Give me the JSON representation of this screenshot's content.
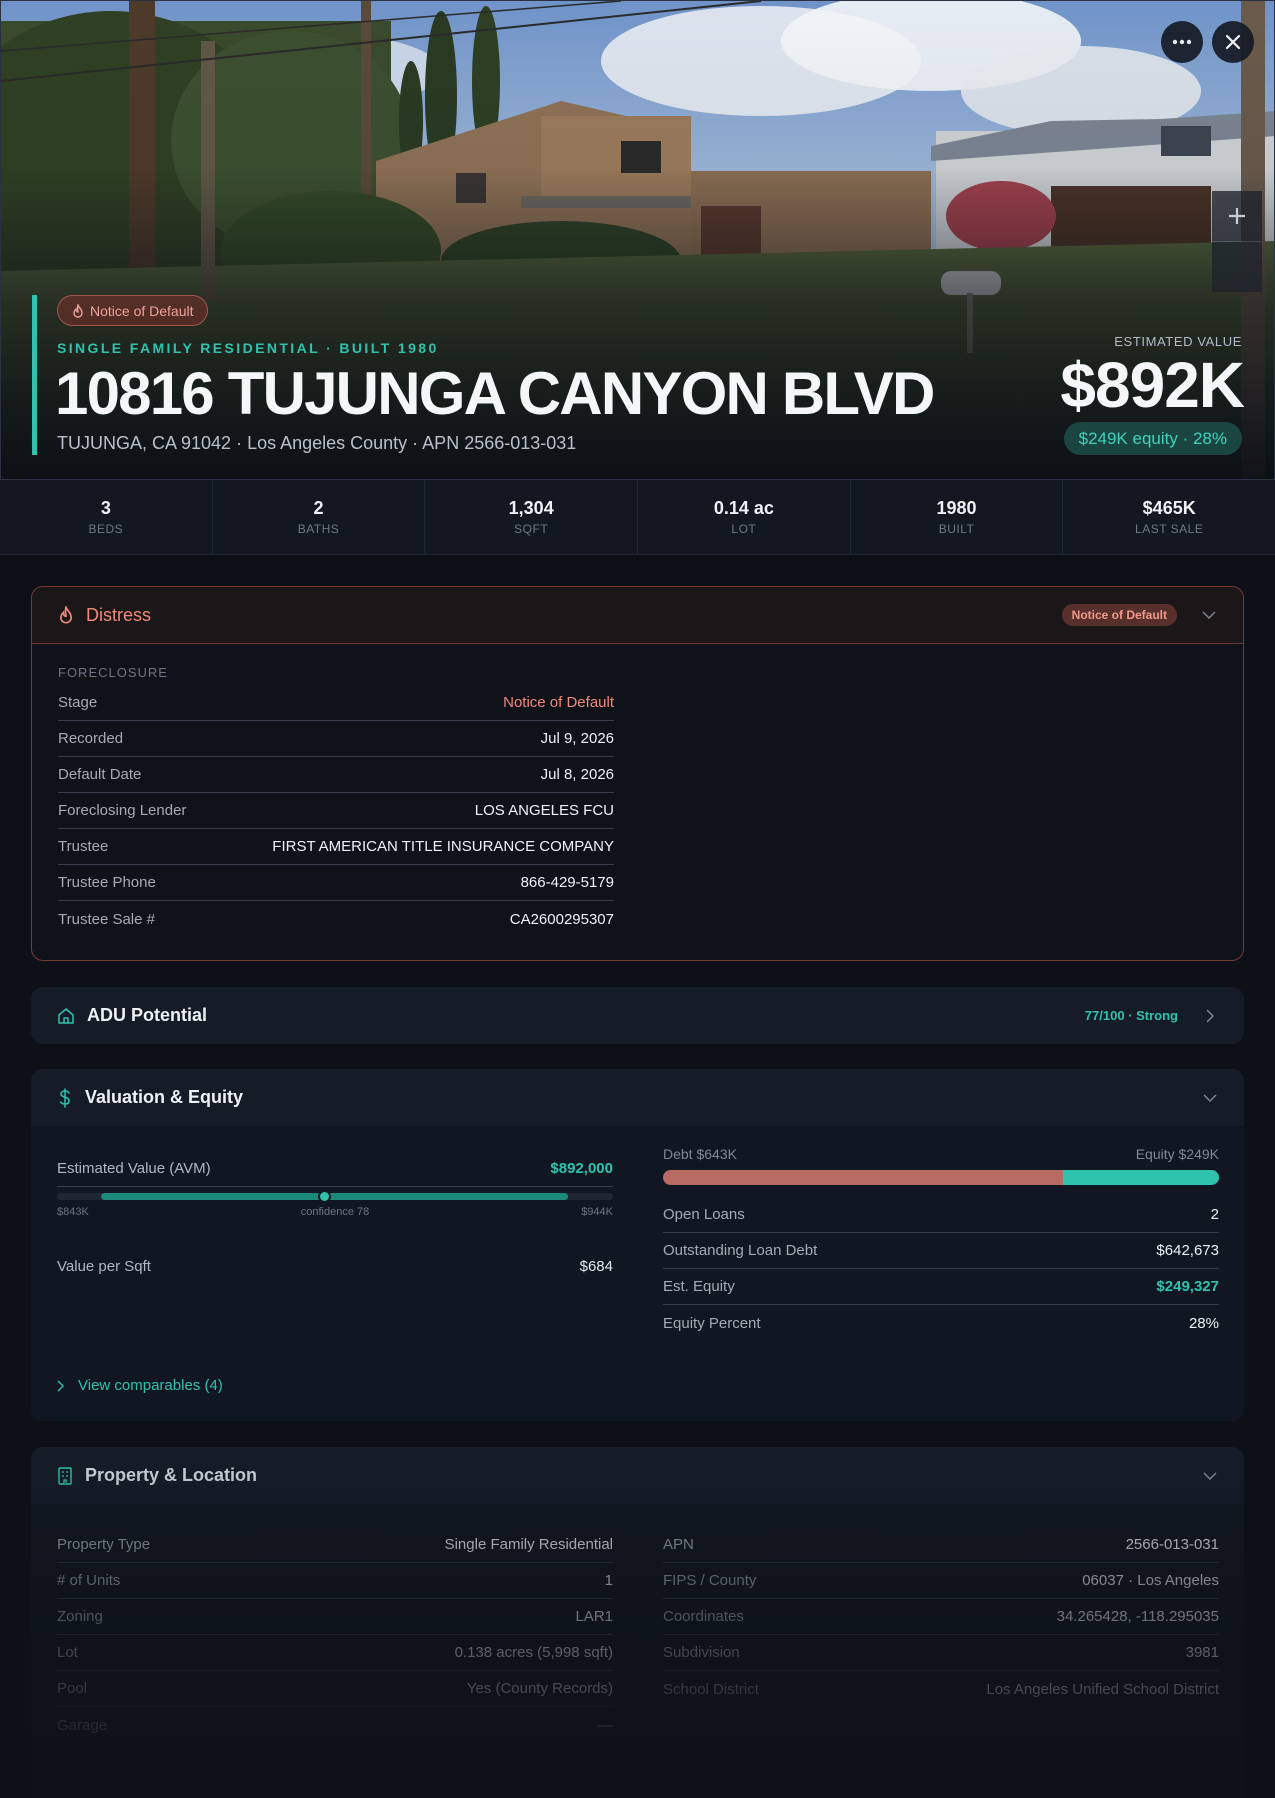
{
  "hero": {
    "status_badge": "Notice of Default",
    "subtitle": "SINGLE FAMILY RESIDENTIAL · BUILT 1980",
    "title": "10816 TUJUNGA CANYON BLVD",
    "address_line": "TUJUNGA, CA 91042 · Los Angeles County · APN 2566-013-031",
    "estimated_label": "ESTIMATED VALUE",
    "estimated_value": "$892K",
    "equity_summary": "$249K equity · 28%",
    "icons": {
      "more": "more-horizontal-icon",
      "close": "close-icon",
      "zoom_in": "plus-icon",
      "zoom_out": "minus-icon",
      "badge": "flame-icon"
    }
  },
  "stats": [
    {
      "value": "3",
      "label": "BEDS"
    },
    {
      "value": "2",
      "label": "BATHS"
    },
    {
      "value": "1,304",
      "label": "SQFT"
    },
    {
      "value": "0.14 ac",
      "label": "LOT"
    },
    {
      "value": "1980",
      "label": "BUILT"
    },
    {
      "value": "$465K",
      "label": "LAST SALE"
    }
  ],
  "distress": {
    "title": "Distress",
    "badge": "Notice of Default",
    "section_label": "FORECLOSURE",
    "rows": [
      {
        "label": "Stage",
        "value": "Notice of Default"
      },
      {
        "label": "Recorded",
        "value": "Jul 9, 2026"
      },
      {
        "label": "Default Date",
        "value": "Jul 8, 2026"
      },
      {
        "label": "Foreclosing Lender",
        "value": "LOS ANGELES FCU"
      },
      {
        "label": "Trustee",
        "value": "FIRST AMERICAN TITLE INSURANCE COMPANY"
      },
      {
        "label": "Trustee Phone",
        "value": "866-429-5179"
      },
      {
        "label": "Trustee Sale #",
        "value": "CA2600295307"
      }
    ]
  },
  "adu": {
    "title": "ADU Potential",
    "score": "77/100 · Strong"
  },
  "valuation": {
    "title": "Valuation & Equity",
    "avm_label": "Estimated Value (AVM)",
    "avm_value": "$892,000",
    "range_low": "$843K",
    "range_high": "$944K",
    "confidence": "confidence 78",
    "range_position": 0.48,
    "value_per_sqft_label": "Value per Sqft",
    "value_per_sqft": "$684",
    "debt_label": "Debt $643K",
    "equity_label": "Equity $249K",
    "debt_fraction": 0.72,
    "loans": [
      {
        "label": "Open Loans",
        "value": "2"
      },
      {
        "label": "Outstanding Loan Debt",
        "value": "$642,673"
      },
      {
        "label": "Est. Equity",
        "value": "$249,327"
      },
      {
        "label": "Equity Percent",
        "value": "28%"
      }
    ],
    "comparables_link": "View comparables (4)"
  },
  "property": {
    "title": "Property & Location",
    "left_rows": [
      {
        "label": "Property Type",
        "value": "Single Family Residential"
      },
      {
        "label": "# of Units",
        "value": "1"
      },
      {
        "label": "Zoning",
        "value": "LAR1"
      },
      {
        "label": "Lot",
        "value": "0.138 acres (5,998 sqft)"
      },
      {
        "label": "Pool",
        "value": "Yes (County Records)"
      },
      {
        "label": "Garage",
        "value": "—"
      }
    ],
    "right_rows": [
      {
        "label": "APN",
        "value": "2566-013-031"
      },
      {
        "label": "FIPS / County",
        "value": "06037 · Los Angeles"
      },
      {
        "label": "Coordinates",
        "value": "34.265428, -118.295035"
      },
      {
        "label": "Subdivision",
        "value": "3981"
      },
      {
        "label": "School District",
        "value": "Los Angeles Unified School District"
      }
    ]
  },
  "colors": {
    "accent": "#2fc2ad",
    "distress": "#f08a7c",
    "debt": "#b76b62",
    "background": "#0d1117"
  }
}
